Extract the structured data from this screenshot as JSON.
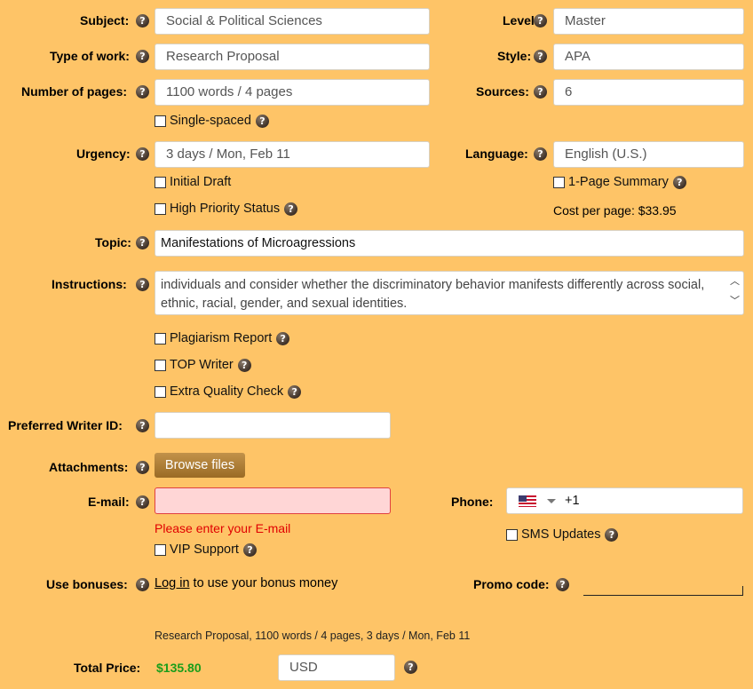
{
  "subject": {
    "label": "Subject:",
    "value": "Social & Political Sciences"
  },
  "level": {
    "label": "Level:",
    "value": "Master"
  },
  "type_of_work": {
    "label": "Type of work:",
    "value": "Research Proposal"
  },
  "style": {
    "label": "Style:",
    "value": "APA"
  },
  "pages": {
    "label": "Number of pages:",
    "value": "1100 words / 4 pages"
  },
  "sources": {
    "label": "Sources:",
    "value": "6"
  },
  "single_spaced": {
    "label": "Single-spaced"
  },
  "urgency": {
    "label": "Urgency:",
    "value": "3 days / Mon, Feb 11"
  },
  "language": {
    "label": "Language:",
    "value": "English (U.S.)"
  },
  "initial_draft": {
    "label": "Initial Draft"
  },
  "one_page_summary": {
    "label": "1-Page Summary"
  },
  "high_priority": {
    "label": "High Priority Status"
  },
  "cost_per_page": "Cost per page: $33.95",
  "topic": {
    "label": "Topic:",
    "value": "Manifestations of Microagressions"
  },
  "instructions": {
    "label": "Instructions:",
    "value": "individuals and consider whether the discriminatory behavior manifests differently across social, ethnic, racial, gender, and sexual identities."
  },
  "plagiarism_report": {
    "label": "Plagiarism Report"
  },
  "top_writer": {
    "label": "TOP Writer"
  },
  "extra_quality": {
    "label": "Extra Quality Check"
  },
  "writer_id": {
    "label": "Preferred Writer ID:",
    "value": ""
  },
  "attachments": {
    "label": "Attachments:",
    "button": "Browse files"
  },
  "email": {
    "label": "E-mail:",
    "value": "",
    "error": "Please enter your E-mail"
  },
  "phone": {
    "label": "Phone:",
    "value": "+1"
  },
  "sms_updates": {
    "label": "SMS Updates"
  },
  "vip_support": {
    "label": "VIP Support"
  },
  "bonuses": {
    "label": "Use bonuses:",
    "link": "Log in",
    "text": "to use your bonus money"
  },
  "promo": {
    "label": "Promo code:",
    "value": ""
  },
  "summary": "Research Proposal, 1100 words / 4 pages, 3 days / Mon, Feb 11",
  "total": {
    "label": "Total Price:",
    "value": "$135.80",
    "currency": "USD"
  },
  "help_glyph": "?",
  "colors": {
    "background": "#fec467",
    "price": "#1a9e1a",
    "error": "#e00000",
    "button": "#a9782c"
  }
}
